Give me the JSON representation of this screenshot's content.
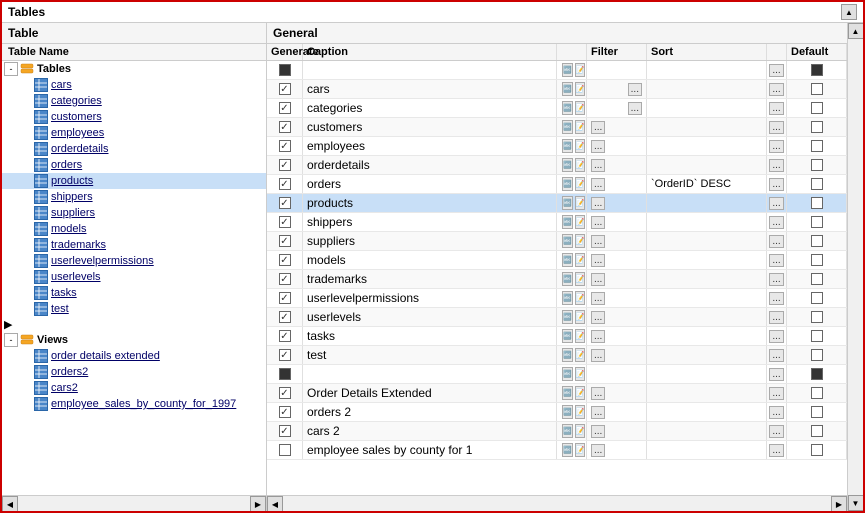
{
  "title": "Tables",
  "panels": {
    "left": {
      "header": "Table",
      "col_header": "Table Name"
    },
    "right": {
      "header": "General",
      "columns": [
        "Generate",
        "Caption",
        "Filter",
        "Sort",
        "Default"
      ]
    }
  },
  "tree": {
    "groups": [
      {
        "name": "Tables",
        "expanded": true,
        "items": [
          "cars",
          "categories",
          "customers",
          "employees",
          "orderdetails",
          "orders",
          "products",
          "shippers",
          "suppliers",
          "models",
          "trademarks",
          "userlevelpermissions",
          "userlevels",
          "tasks",
          "test"
        ]
      },
      {
        "name": "Views",
        "expanded": true,
        "items": [
          "order details extended",
          "orders2",
          "cars2",
          "employee_sales_by_county_for_1997"
        ]
      }
    ]
  },
  "rows": [
    {
      "name": "Tables",
      "generate": "square",
      "caption": "",
      "filter": "",
      "sort": "",
      "default": "square",
      "isGroup": true
    },
    {
      "name": "cars",
      "generate": "checked",
      "caption": "cars",
      "filter": "...",
      "sort": "",
      "default": "unchecked"
    },
    {
      "name": "categories",
      "generate": "checked",
      "caption": "categories",
      "filter": "...",
      "sort": "",
      "default": "unchecked"
    },
    {
      "name": "customers",
      "generate": "checked",
      "caption": "customers",
      "filter": "...",
      "sort": "",
      "default": "unchecked"
    },
    {
      "name": "employees",
      "generate": "checked",
      "caption": "employees",
      "filter": "...",
      "sort": "",
      "default": "unchecked"
    },
    {
      "name": "orderdetails",
      "generate": "checked",
      "caption": "orderdetails",
      "filter": "...",
      "sort": "",
      "default": "unchecked"
    },
    {
      "name": "orders",
      "generate": "checked",
      "caption": "orders",
      "filter": "...",
      "sort": "`OrderID` DESC",
      "default": "unchecked"
    },
    {
      "name": "products",
      "generate": "checked",
      "caption": "products",
      "filter": "...",
      "sort": "",
      "default": "unchecked"
    },
    {
      "name": "shippers",
      "generate": "checked",
      "caption": "shippers",
      "filter": "...",
      "sort": "",
      "default": "unchecked"
    },
    {
      "name": "suppliers",
      "generate": "checked",
      "caption": "suppliers",
      "filter": "...",
      "sort": "",
      "default": "unchecked"
    },
    {
      "name": "models",
      "generate": "checked",
      "caption": "models",
      "filter": "...",
      "sort": "",
      "default": "unchecked"
    },
    {
      "name": "trademarks",
      "generate": "checked",
      "caption": "trademarks",
      "filter": "...",
      "sort": "",
      "default": "unchecked"
    },
    {
      "name": "userlevelpermissions",
      "generate": "checked",
      "caption": "userlevelpermissions",
      "filter": "...",
      "sort": "",
      "default": "unchecked"
    },
    {
      "name": "userlevels",
      "generate": "checked",
      "caption": "userlevels",
      "filter": "...",
      "sort": "",
      "default": "unchecked"
    },
    {
      "name": "tasks",
      "generate": "checked",
      "caption": "tasks",
      "filter": "...",
      "sort": "",
      "default": "unchecked"
    },
    {
      "name": "test",
      "generate": "checked",
      "caption": "test",
      "filter": "...",
      "sort": "",
      "default": "unchecked"
    },
    {
      "name": "Views",
      "generate": "square",
      "caption": "",
      "filter": "",
      "sort": "",
      "default": "square",
      "isGroup": true
    },
    {
      "name": "order details extended",
      "generate": "checked",
      "caption": "Order Details Extended",
      "filter": "...",
      "sort": "",
      "default": "unchecked"
    },
    {
      "name": "orders2",
      "generate": "checked",
      "caption": "orders 2",
      "filter": "...",
      "sort": "",
      "default": "unchecked"
    },
    {
      "name": "cars2",
      "generate": "checked",
      "caption": "cars 2",
      "filter": "...",
      "sort": "",
      "default": "unchecked"
    },
    {
      "name": "employee_sales",
      "generate": "unchecked",
      "caption": "employee sales by county for 1",
      "filter": "...",
      "sort": "",
      "default": "unchecked"
    }
  ],
  "colors": {
    "border": "#cc0000",
    "link": "#0000cc",
    "selected_bg": "#c8dff7"
  }
}
